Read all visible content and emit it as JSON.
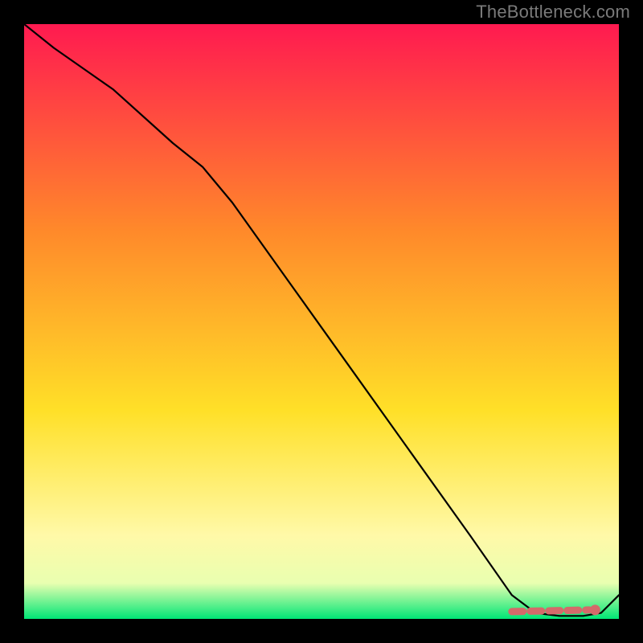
{
  "watermark": "TheBottleneck.com",
  "colors": {
    "frame_bg": "#000000",
    "watermark": "#7a7a7a",
    "line": "#000000",
    "band": "#d46a6a",
    "dot": "#d46a6a",
    "gradient_top": "#ff1a50",
    "gradient_mid1": "#ff8a2a",
    "gradient_mid2": "#ffe028",
    "gradient_mid3": "#fff9a8",
    "gradient_mid4": "#e9ffb0",
    "gradient_bottom": "#00e676"
  },
  "chart_data": {
    "type": "line",
    "title": "",
    "xlabel": "",
    "ylabel": "",
    "xlim": [
      0,
      100
    ],
    "ylim": [
      0,
      100
    ],
    "series": [
      {
        "name": "curve",
        "x": [
          0,
          5,
          15,
          25,
          30,
          35,
          45,
          55,
          65,
          75,
          82,
          86,
          90,
          94,
          97,
          100
        ],
        "y": [
          100,
          96,
          89,
          80,
          76,
          70,
          56,
          42,
          28,
          14,
          4,
          1,
          0.5,
          0.5,
          1,
          4
        ]
      }
    ],
    "highlight_band": {
      "name": "optimal-range",
      "x_start": 82,
      "x_end": 95,
      "y": 1.5
    },
    "marker": {
      "name": "optimal-point",
      "x": 96,
      "y": 1.5
    }
  }
}
